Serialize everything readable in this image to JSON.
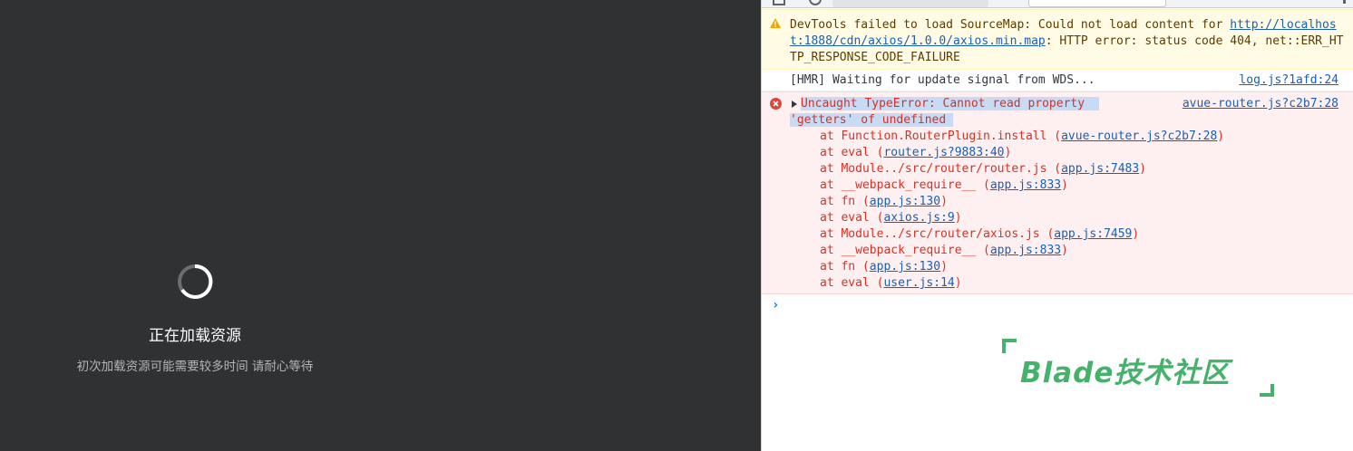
{
  "app": {
    "loading_title": "正在加载资源",
    "loading_subtitle": "初次加载资源可能需要较多时间 请耐心等待"
  },
  "console": {
    "warning": {
      "prefix": "DevTools failed to load SourceMap: Could not load content for ",
      "url": "http://localhost:1888/cdn/axios/1.0.0/axios.min.map",
      "suffix": ": HTTP error: status code 404, net::ERR_HTTP_RESPONSE_CODE_FAILURE"
    },
    "log": {
      "text": "[HMR] Waiting for update signal from WDS...",
      "source": "log.js?1afd:24"
    },
    "error": {
      "line1": "Uncaught TypeError: Cannot read property",
      "line2": "'getters' of undefined",
      "source": "avue-router.js?c2b7:28",
      "stack": [
        {
          "prefix": "at Function.RouterPlugin.install (",
          "link": "avue-router.js?c2b7:28",
          "suffix": ")"
        },
        {
          "prefix": "at eval (",
          "link": "router.js?9883:40",
          "suffix": ")"
        },
        {
          "prefix": "at Module../src/router/router.js (",
          "link": "app.js:7483",
          "suffix": ")"
        },
        {
          "prefix": "at __webpack_require__ (",
          "link": "app.js:833",
          "suffix": ")"
        },
        {
          "prefix": "at fn (",
          "link": "app.js:130",
          "suffix": ")"
        },
        {
          "prefix": "at eval (",
          "link": "axios.js:9",
          "suffix": ")"
        },
        {
          "prefix": "at Module../src/router/axios.js (",
          "link": "app.js:7459",
          "suffix": ")"
        },
        {
          "prefix": "at __webpack_require__ (",
          "link": "app.js:833",
          "suffix": ")"
        },
        {
          "prefix": "at fn (",
          "link": "app.js:130",
          "suffix": ")"
        },
        {
          "prefix": "at eval (",
          "link": "user.js:14",
          "suffix": ")"
        }
      ]
    },
    "prompt_symbol": "›"
  },
  "watermark": {
    "text": "Blade技术社区"
  },
  "colors": {
    "app_bg": "#303133",
    "error_text": "#d93025",
    "link": "#1a5fb4",
    "watermark": "#45b26b"
  }
}
